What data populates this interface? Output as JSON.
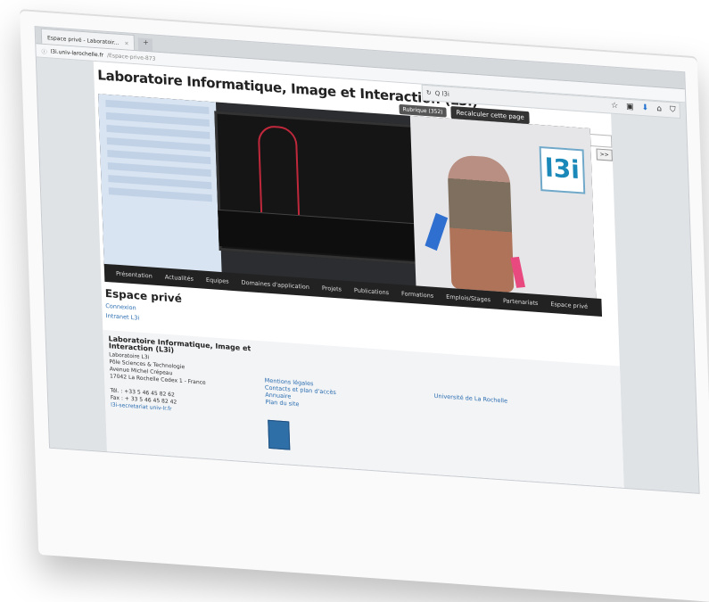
{
  "browser": {
    "tab_title": "Espace privé - Laboratoir...",
    "tab_close": "×",
    "new_tab": "+",
    "url_domain": "l3i.univ-larochelle.fr",
    "url_path": "/Espace-prive-873"
  },
  "toolbar": {
    "search_text": "Q  l3i",
    "icons": [
      "star-icon",
      "clipboard-icon",
      "download-icon",
      "home-icon",
      "shield-icon"
    ]
  },
  "site": {
    "title": "Laboratoire Informatique, Image et Interaction (L3i)",
    "rubrique": "Rubrique (352)",
    "recalc_button": "Recalculer cette page",
    "search_go": ">>",
    "logo": "l3i"
  },
  "nav": {
    "items": [
      "Présentation",
      "Actualités",
      "Equipes",
      "Domaines d'application",
      "Projets",
      "Publications",
      "Formations",
      "Emplois/Stages",
      "Partenariats",
      "Espace privé"
    ]
  },
  "section": {
    "title": "Espace privé",
    "links": [
      "Connexion",
      "Intranet L3i"
    ]
  },
  "footer": {
    "lab_title": "Laboratoire Informatique, Image et Interaction (L3i)",
    "address_lines": [
      "Laboratoire L3i",
      "Pôle Sciences & Technologie",
      "Avenue Michel Crépeau",
      "17042 La Rochelle Cedex 1 - France",
      "",
      "Tél. : +33 5 46 45 82 62",
      "Fax : + 33 5 46 45 82 42"
    ],
    "email_link": "l3i-secretariat univ-lr.fr",
    "links": [
      "Mentions légales",
      "Contacts et plan d'accès",
      "Annuaire",
      "Plan du site"
    ],
    "university_link": "Université de La Rochelle"
  }
}
